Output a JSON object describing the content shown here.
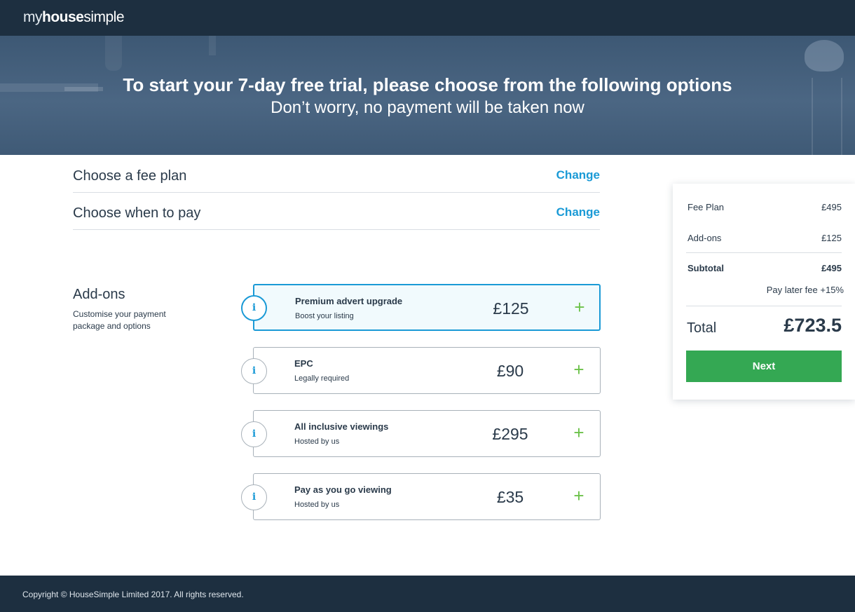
{
  "header": {
    "logo_part1": "my",
    "logo_part2": "house",
    "logo_part3": "simple"
  },
  "hero": {
    "title": "To start your 7-day free trial, please choose from the following options",
    "subtitle": "Don’t worry, no payment will be taken now"
  },
  "steps": [
    {
      "label": "Choose a fee plan",
      "action": "Change"
    },
    {
      "label": "Choose when to pay",
      "action": "Change"
    }
  ],
  "addons": {
    "title": "Add-ons",
    "description": "Customise your payment package and options",
    "items": [
      {
        "name": "Premium advert upgrade",
        "subtitle": "Boost your listing",
        "price": "£125",
        "selected": true
      },
      {
        "name": "EPC",
        "subtitle": "Legally required",
        "price": "£90",
        "selected": false
      },
      {
        "name": "All inclusive viewings",
        "subtitle": "Hosted by us",
        "price": "£295",
        "selected": false
      },
      {
        "name": "Pay as you go viewing",
        "subtitle": "Hosted by us",
        "price": "£35",
        "selected": false
      }
    ],
    "info_glyph": "i",
    "add_glyph": "+"
  },
  "summary": {
    "fee_plan_label": "Fee Plan",
    "fee_plan_value": "£495",
    "addons_label": "Add-ons",
    "addons_value": "£125",
    "subtotal_label": "Subtotal",
    "subtotal_value": "£495",
    "pay_later_label": "Pay later fee",
    "pay_later_value": "+15%",
    "total_label": "Total",
    "total_value": "£723.5",
    "next_label": "Next"
  },
  "footer": {
    "copyright": "Copyright © HouseSimple Limited 2017. All rights reserved."
  },
  "colors": {
    "navy": "#1d2f40",
    "accent_blue": "#1a9ad6",
    "plus_green": "#6cc24a",
    "button_green": "#34a853"
  },
  "icons": {
    "info": "info-icon",
    "add": "plus-icon"
  }
}
